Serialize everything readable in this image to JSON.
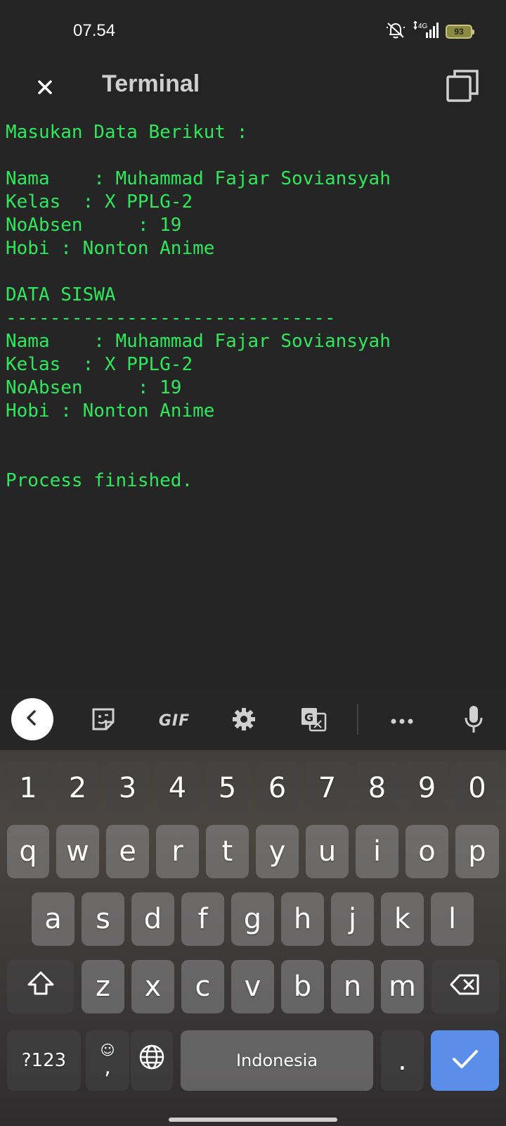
{
  "status_bar": {
    "time": "07.54",
    "network": "4G",
    "battery": "93"
  },
  "app_bar": {
    "title": "Terminal",
    "close_icon": "close-icon",
    "copy_icon": "copy-icon"
  },
  "terminal": {
    "lines": [
      "Masukan Data Berikut :",
      "",
      "Nama    : Muhammad Fajar Soviansyah",
      "Kelas  : X PPLG-2",
      "NoAbsen     : 19",
      "Hobi : Nonton Anime",
      "",
      "DATA SISWA",
      "------------------------------",
      "Nama    : Muhammad Fajar Soviansyah",
      "Kelas  : X PPLG-2",
      "NoAbsen     : 19",
      "Hobi : Nonton Anime",
      "",
      "",
      "Process finished."
    ],
    "text_color": "#2ee85c"
  },
  "keyboard": {
    "toolbar": {
      "gif_label": "GIF",
      "icons": [
        "back-icon",
        "sticker-icon",
        "gif-icon",
        "settings-icon",
        "translate-icon",
        "more-icon",
        "mic-icon"
      ]
    },
    "number_row": [
      "1",
      "2",
      "3",
      "4",
      "5",
      "6",
      "7",
      "8",
      "9",
      "0"
    ],
    "row1": [
      "q",
      "w",
      "e",
      "r",
      "t",
      "y",
      "u",
      "i",
      "o",
      "p"
    ],
    "row2": [
      "a",
      "s",
      "d",
      "f",
      "g",
      "h",
      "j",
      "k",
      "l"
    ],
    "row3": [
      "z",
      "x",
      "c",
      "v",
      "b",
      "n",
      "m"
    ],
    "bottom": {
      "symbols_label": "?123",
      "comma_label": ",",
      "space_label": "Indonesia",
      "period_label": "."
    },
    "enter_color": "#5b8ee8"
  }
}
